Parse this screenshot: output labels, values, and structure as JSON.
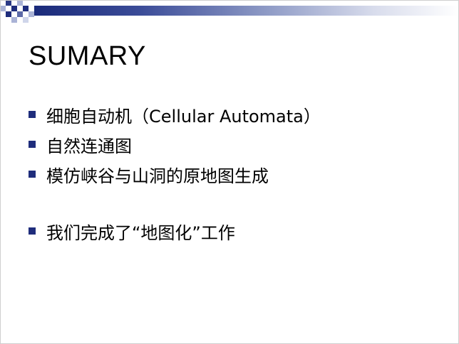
{
  "slide": {
    "title": "SUMARY",
    "accent_color": "#1f2d7c",
    "bullets": [
      "细胞自动机（Cellular Automata）",
      "自然连通图",
      "模仿峡谷与山洞的原地图生成",
      "我们完成了“地图化”工作"
    ]
  }
}
